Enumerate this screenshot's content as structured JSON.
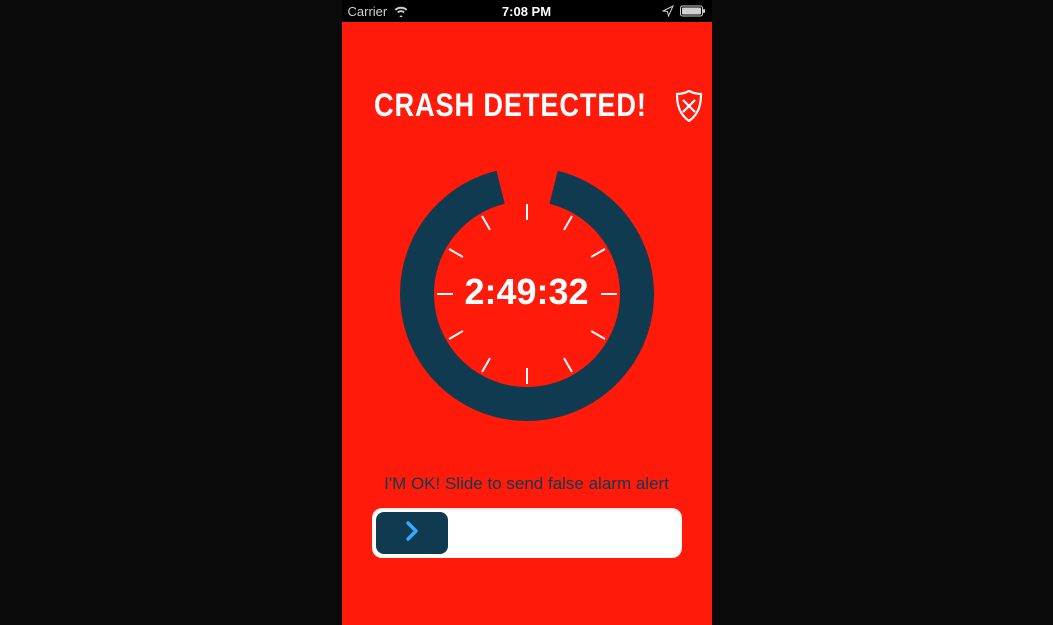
{
  "status_bar": {
    "carrier": "Carrier",
    "time": "7:08 PM"
  },
  "title": "CRASH DETECTED!",
  "timer": "2:49:32",
  "instruction": "I'M OK! Slide to send false alarm alert",
  "colors": {
    "background": "#ff1a0a",
    "ring": "#103a4f",
    "text_dark": "#0f3a4f",
    "white": "#ffffff"
  },
  "ring_gap_degrees": 28
}
